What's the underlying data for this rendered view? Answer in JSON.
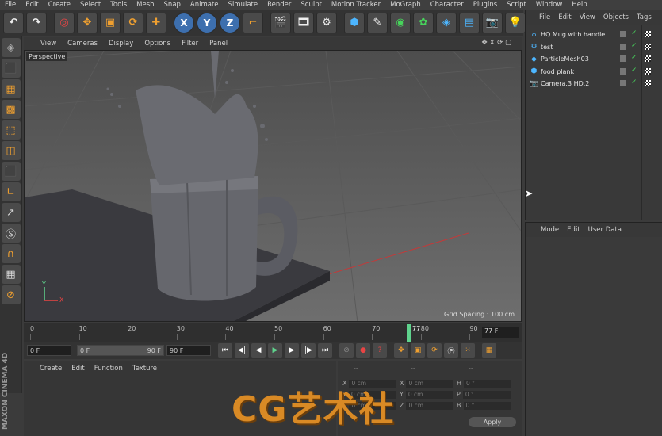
{
  "menubar": [
    "File",
    "Edit",
    "Create",
    "Select",
    "Tools",
    "Mesh",
    "Snap",
    "Animate",
    "Simulate",
    "Render",
    "Sculpt",
    "Motion Tracker",
    "MoGraph",
    "Character",
    "Plugins",
    "Script",
    "Window",
    "Help"
  ],
  "toolbar": {
    "icons": [
      "undo-icon",
      "redo-icon",
      "live-selection-icon",
      "move-icon",
      "scale-icon",
      "rotate-icon",
      "last-tool-icon",
      "x-axis-icon",
      "y-axis-icon",
      "z-axis-icon",
      "world-coordinate-icon",
      "render-view-icon",
      "render-picture-viewer-icon",
      "edit-render-settings-icon",
      "cube-icon",
      "pen-icon",
      "subdivision-icon",
      "cloner-icon",
      "deformer-icon",
      "floor-icon",
      "camera-icon",
      "light-icon"
    ]
  },
  "viewport": {
    "menu": [
      "View",
      "Cameras",
      "Display",
      "Options",
      "Filter",
      "Panel"
    ],
    "label": "Perspective",
    "grid_spacing": "Grid Spacing : 100 cm",
    "axis_y": "Y",
    "axis_x": "X"
  },
  "timeline": {
    "ticks": [
      "0",
      "10",
      "20",
      "30",
      "40",
      "50",
      "60",
      "70",
      "80",
      "90"
    ],
    "current": "77",
    "current_frame": "77 F"
  },
  "transport": {
    "start": "0 F",
    "range_start": "0 F",
    "range_end": "90 F",
    "end": "90 F"
  },
  "material_manager": {
    "menu": [
      "Create",
      "Edit",
      "Function",
      "Texture"
    ]
  },
  "coordinates": {
    "rows": [
      {
        "a": "X",
        "av": "0 cm",
        "b": "X",
        "bv": "0 cm",
        "c": "H",
        "cv": "0 °"
      },
      {
        "a": "Y",
        "av": "0 cm",
        "b": "Y",
        "bv": "0 cm",
        "c": "P",
        "cv": "0 °"
      },
      {
        "a": "Z",
        "av": "0 cm",
        "b": "Z",
        "bv": "0 cm",
        "c": "B",
        "cv": "0 °"
      }
    ],
    "apply": "Apply",
    "header": "--"
  },
  "object_manager": {
    "menu": [
      "File",
      "Edit",
      "View",
      "Objects",
      "Tags"
    ],
    "objects": [
      {
        "name": "HQ Mug with handle",
        "icon": "null-icon"
      },
      {
        "name": "test",
        "icon": "emitter-icon"
      },
      {
        "name": "ParticleMesh03",
        "icon": "mesh-icon"
      },
      {
        "name": "food plank",
        "icon": "cube-icon"
      },
      {
        "name": "Camera.3 HD.2",
        "icon": "camera-icon"
      }
    ]
  },
  "attribute_manager": {
    "menu": [
      "Mode",
      "Edit",
      "User Data"
    ]
  },
  "brand": "MAXON CINEMA 4D",
  "watermark": "CG艺术社",
  "colors": {
    "accent": "#f0a030",
    "axis_blue": "#3d6fae",
    "playhead": "#5fd38d",
    "selection": "#4db6ff"
  }
}
